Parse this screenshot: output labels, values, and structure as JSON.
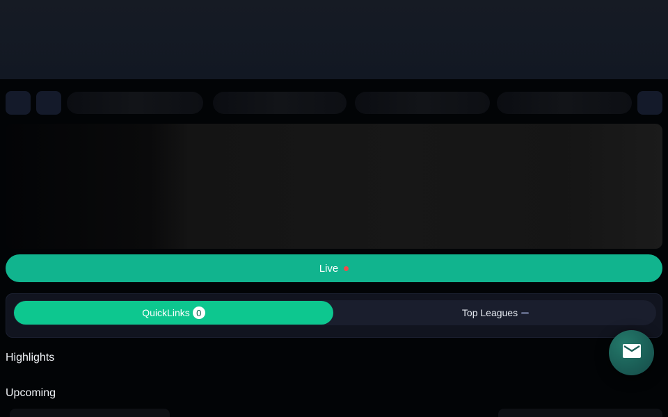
{
  "live_button": {
    "label": "Live",
    "indicator_color": "#f04b4b",
    "background": "#11b48e"
  },
  "tabs": [
    {
      "label": "QuickLinks",
      "badge": "0",
      "active": true
    },
    {
      "label": "Top Leagues",
      "badge": "",
      "active": false
    }
  ],
  "sections": {
    "highlights": "Highlights",
    "upcoming": "Upcoming"
  },
  "fab": {
    "icon": "mail-icon"
  },
  "colors": {
    "accent": "#0dc78f",
    "background": "#020406",
    "header": "#161b24"
  }
}
